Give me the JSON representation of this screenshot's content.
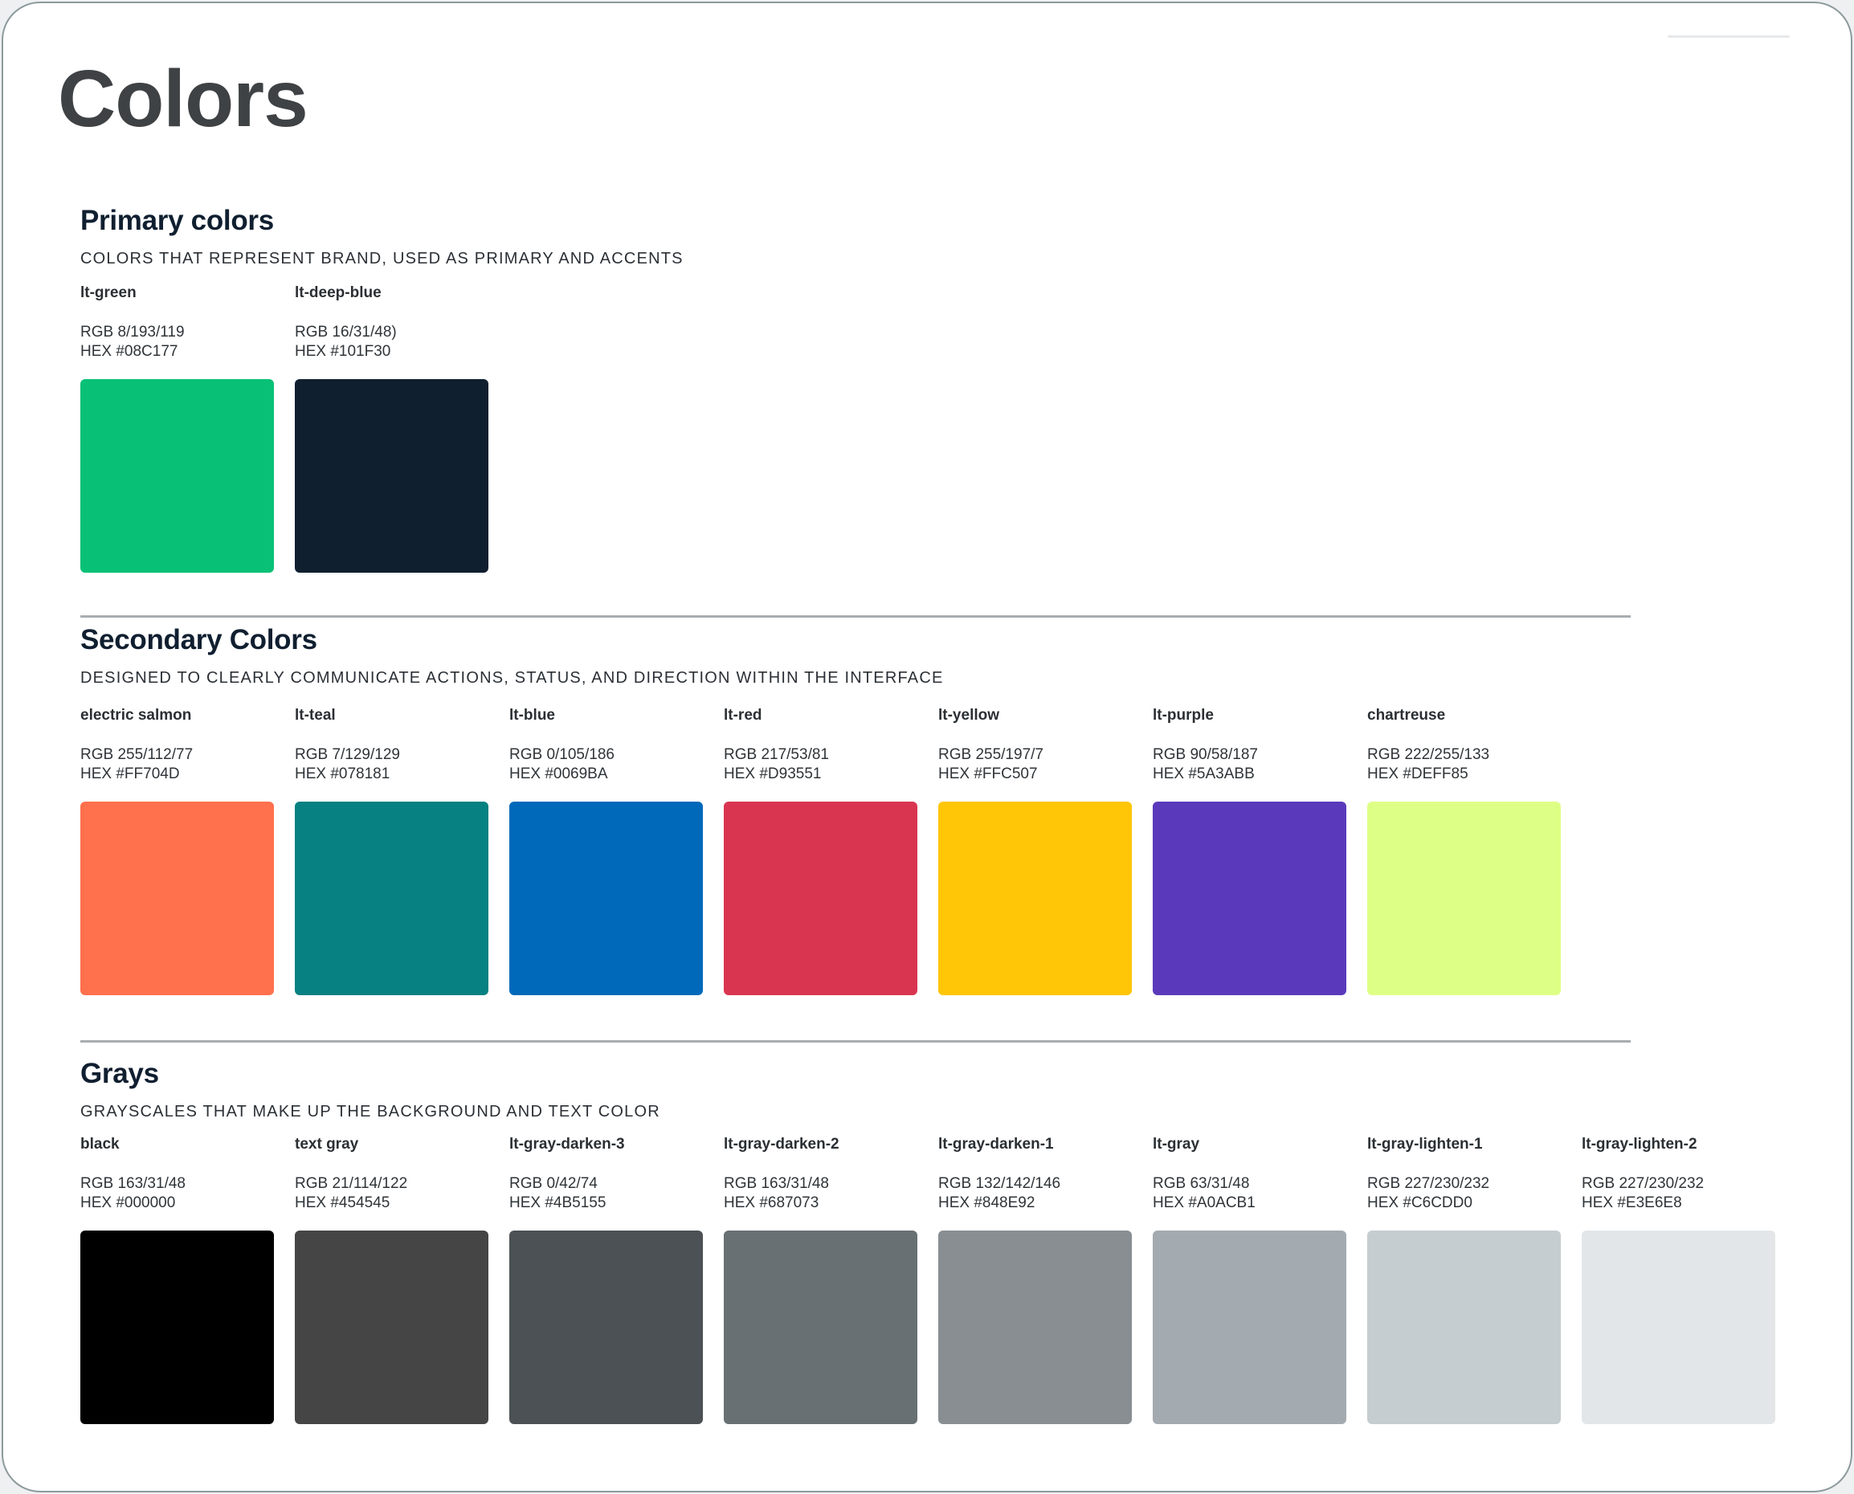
{
  "page": {
    "title": "Colors"
  },
  "primary": {
    "title": "Primary colors",
    "subtitle": "COLORS THAT REPRESENT BRAND, USED AS PRIMARY AND ACCENTS",
    "swatches": [
      {
        "name": "lt-green",
        "rgb": "RGB 8/193/119",
        "hex": "HEX #08C177",
        "color": "#08C177"
      },
      {
        "name": "lt-deep-blue",
        "rgb": "RGB 16/31/48)",
        "hex": "HEX #101F30",
        "color": "#101F30"
      }
    ]
  },
  "secondary": {
    "title": "Secondary Colors",
    "subtitle": "DESIGNED TO CLEARLY COMMUNICATE ACTIONS, STATUS, AND DIRECTION WITHIN THE INTERFACE",
    "swatches": [
      {
        "name": "electric salmon",
        "rgb": "RGB 255/112/77",
        "hex": "HEX #FF704D",
        "color": "#FF704D"
      },
      {
        "name": "lt-teal",
        "rgb": "RGB 7/129/129",
        "hex": "HEX #078181",
        "color": "#078181"
      },
      {
        "name": "lt-blue",
        "rgb": "RGB 0/105/186",
        "hex": "HEX #0069BA",
        "color": "#0069BA"
      },
      {
        "name": "lt-red",
        "rgb": "RGB 217/53/81",
        "hex": "HEX #D93551",
        "color": "#D93551"
      },
      {
        "name": "lt-yellow",
        "rgb": "RGB 255/197/7",
        "hex": "HEX #FFC507",
        "color": "#FFC507"
      },
      {
        "name": "lt-purple",
        "rgb": "RGB 90/58/187",
        "hex": "HEX #5A3ABB",
        "color": "#5A3ABB"
      },
      {
        "name": "chartreuse",
        "rgb": "RGB 222/255/133",
        "hex": "HEX #DEFF85",
        "color": "#DEFF85"
      }
    ]
  },
  "grays": {
    "title": "Grays",
    "subtitle": "GRAYSCALES THAT MAKE UP THE BACKGROUND AND TEXT COLOR",
    "swatches": [
      {
        "name": "black",
        "rgb": "RGB 163/31/48",
        "hex": "HEX #000000",
        "color": "#000000"
      },
      {
        "name": "text gray",
        "rgb": "RGB 21/114/122",
        "hex": "HEX #454545",
        "color": "#454545"
      },
      {
        "name": "lt-gray-darken-3",
        "rgb": "RGB 0/42/74",
        "hex": "HEX #4B5155",
        "color": "#4B5155"
      },
      {
        "name": "lt-gray-darken-2",
        "rgb": "RGB 163/31/48",
        "hex": "HEX #687073",
        "color": "#687073"
      },
      {
        "name": "lt-gray-darken-1",
        "rgb": "RGB 132/142/146",
        "hex": "HEX #848E92",
        "color": "#888E92"
      },
      {
        "name": "lt-gray",
        "rgb": "RGB 63/31/48",
        "hex": "HEX #A0ACB1",
        "color": "#A3AAB0"
      },
      {
        "name": "lt-gray-lighten-1",
        "rgb": "RGB 227/230/232",
        "hex": "HEX #C6CDD0",
        "color": "#C6CDD0"
      },
      {
        "name": "lt-gray-lighten-2",
        "rgb": "RGB 227/230/232",
        "hex": "HEX #E3E6E8",
        "color": "#E3E6E8"
      }
    ]
  }
}
